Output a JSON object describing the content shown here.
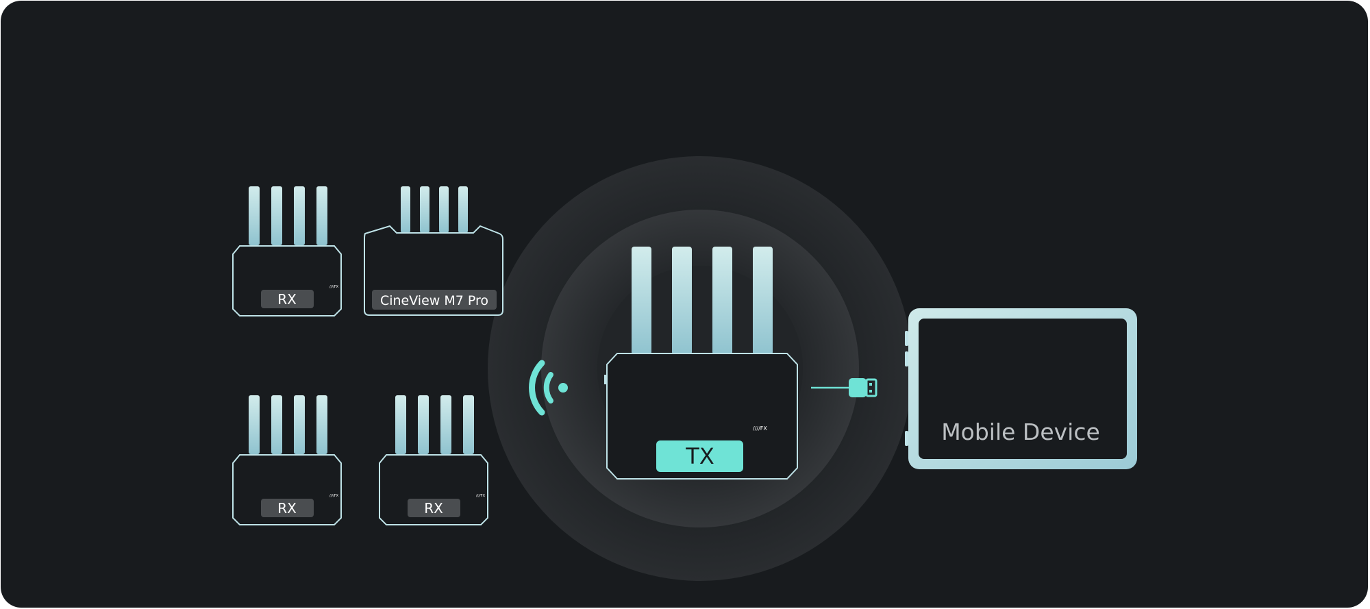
{
  "devices": {
    "rx_top_left": {
      "label": "RX"
    },
    "rx_bottom_left": {
      "label": "RX"
    },
    "rx_bottom_right": {
      "label": "RX"
    },
    "monitor": {
      "label": "CineView M7 Pro"
    },
    "tx": {
      "label": "TX"
    },
    "mobile": {
      "label": "Mobile Device"
    }
  },
  "colors": {
    "background": "#181b1e",
    "accent": "#6fe3d6",
    "antenna_light": "#cfeaea",
    "antenna_dark": "#8ec1cc",
    "outline": "#bfe3e8",
    "label_box": "#4a4d50"
  },
  "icons": {
    "wireless": "wifi-signal-icon",
    "cable": "usb-plug-icon"
  }
}
